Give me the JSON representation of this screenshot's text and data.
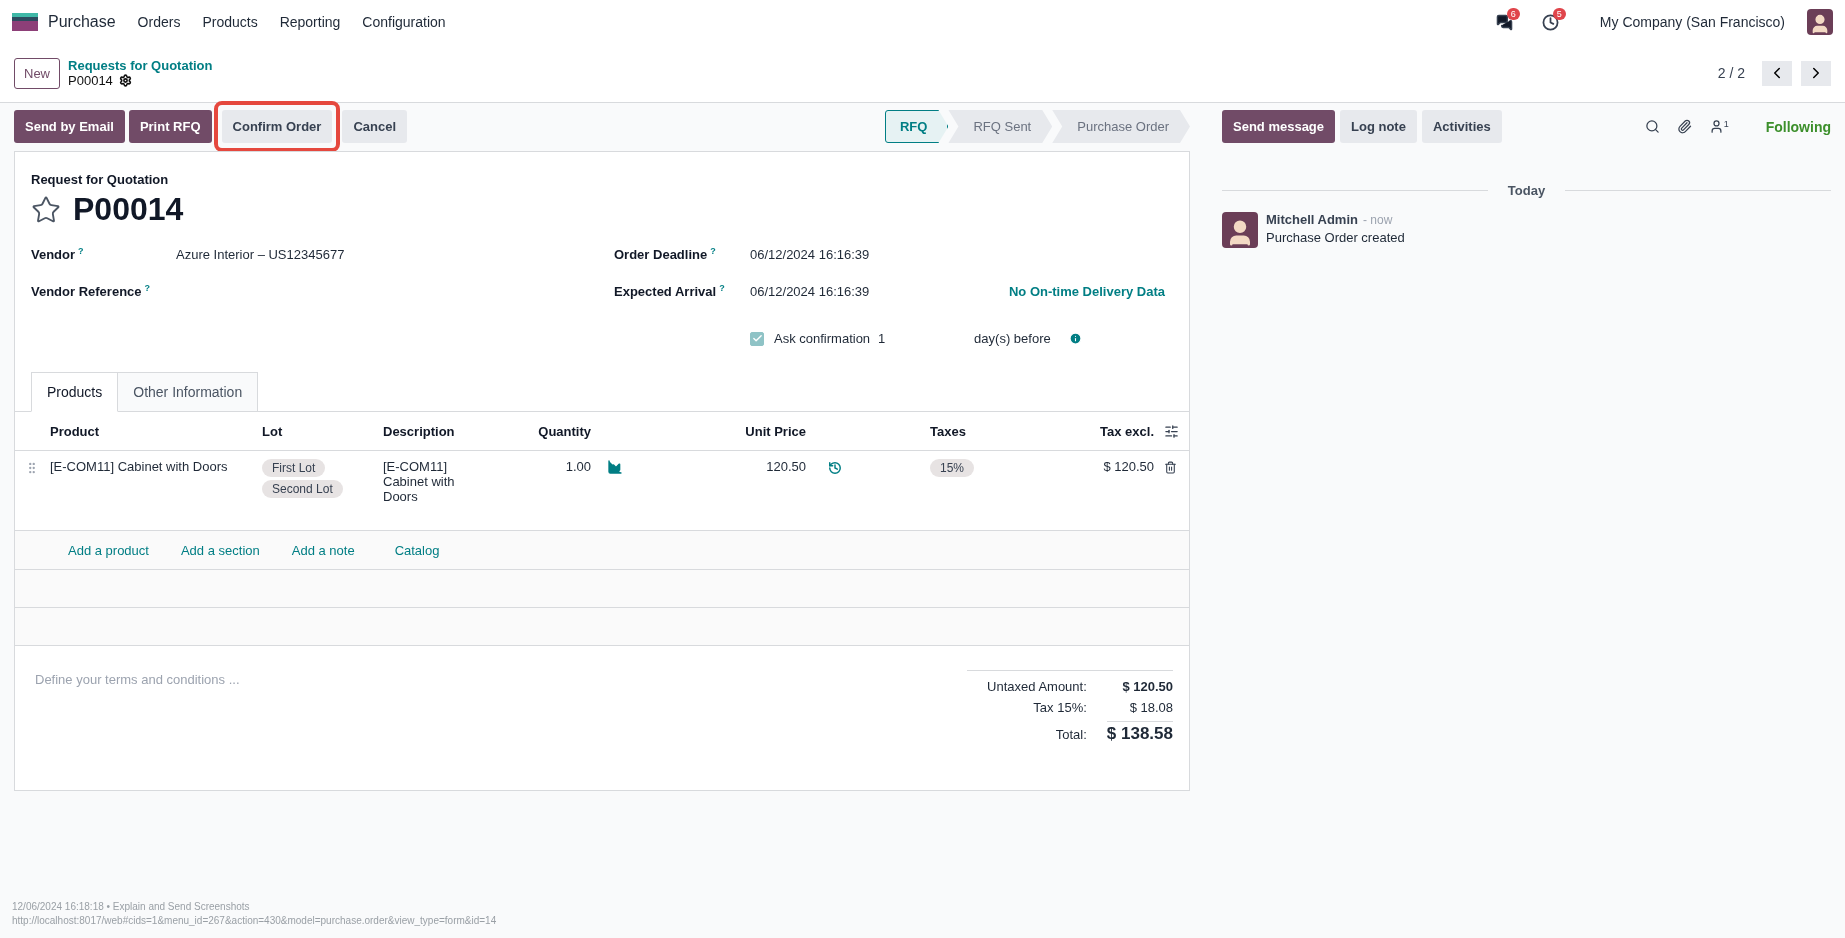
{
  "app_bar": {
    "app_name": "Purchase",
    "menu": [
      "Orders",
      "Products",
      "Reporting",
      "Configuration"
    ],
    "messages_badge": "6",
    "activities_badge": "5",
    "company": "My Company (San Francisco)"
  },
  "control_panel": {
    "new_button": "New",
    "breadcrumb": "Requests for Quotation",
    "record": "P00014",
    "pager": "2 / 2"
  },
  "actions": [
    {
      "label": "Send by Email",
      "kind": "primary",
      "highlighted": false
    },
    {
      "label": "Print RFQ",
      "kind": "primary",
      "highlighted": false
    },
    {
      "label": "Confirm Order",
      "kind": "secondary",
      "highlighted": true
    },
    {
      "label": "Cancel",
      "kind": "secondary",
      "highlighted": false
    }
  ],
  "status_steps": [
    {
      "label": "RFQ",
      "selected": true
    },
    {
      "label": "RFQ Sent",
      "selected": false
    },
    {
      "label": "Purchase Order",
      "selected": false
    }
  ],
  "form": {
    "subtitle": "Request for Quotation",
    "title": "P00014",
    "starred": false,
    "left_fields": [
      {
        "label": "Vendor",
        "help": "?",
        "value": "Azure Interior – US12345677"
      },
      {
        "label": "Vendor Reference",
        "help": "?"
      }
    ],
    "right_fields": [
      {
        "label": "Order Deadline",
        "help": "?",
        "value": "06/12/2024 16:16:39"
      },
      {
        "label": "Expected Arrival",
        "help": "?",
        "value": "06/12/2024 16:16:39",
        "link": "No On-time Delivery Data"
      }
    ],
    "ask_confirmation": {
      "checked": true,
      "label": "Ask confirmation",
      "days": "1",
      "suffix": "day(s) before"
    },
    "tabs": [
      {
        "label": "Products",
        "selected": true
      },
      {
        "label": "Other Information",
        "selected": false
      }
    ],
    "table": {
      "columns": [
        "Product",
        "Lot",
        "Description",
        "Quantity",
        "Unit Price",
        "Taxes",
        "Tax excl."
      ],
      "rows": [
        {
          "product": "[E-COM11] Cabinet with Doors",
          "lots": [
            "First Lot",
            "Second Lot"
          ],
          "description": "[E-COM11] Cabinet with Doors",
          "quantity": "1.00",
          "unit_price": "120.50",
          "taxes": [
            "15%"
          ],
          "subtotal": "$ 120.50"
        }
      ],
      "add_links": [
        "Add a product",
        "Add a section",
        "Add a note",
        "Catalog"
      ]
    },
    "terms_placeholder": "Define your terms and conditions ...",
    "totals": [
      {
        "label": "Untaxed Amount:",
        "value": "$ 120.50",
        "kind": "bold"
      },
      {
        "label": "Tax 15%:",
        "value": "$ 18.08",
        "kind": "plain"
      },
      {
        "label": "Total:",
        "value": "$ 138.58",
        "kind": "grand"
      }
    ]
  },
  "chatter": {
    "buttons": [
      {
        "label": "Send message",
        "kind": "primary"
      },
      {
        "label": "Log note",
        "kind": "secondary"
      },
      {
        "label": "Activities",
        "kind": "secondary"
      }
    ],
    "followers_count": "1",
    "follow_status": "Following",
    "date_separator": "Today",
    "messages": [
      {
        "author": "Mitchell Admin",
        "time": "- now",
        "body": "Purchase Order created"
      }
    ]
  },
  "footer": {
    "stamp": "12/06/2024 16:18:18 • Explain and Send Screenshots",
    "url": "http://localhost:8017/web#cids=1&menu_id=267&action=430&model=purchase.order&view_type=form&id=14"
  }
}
